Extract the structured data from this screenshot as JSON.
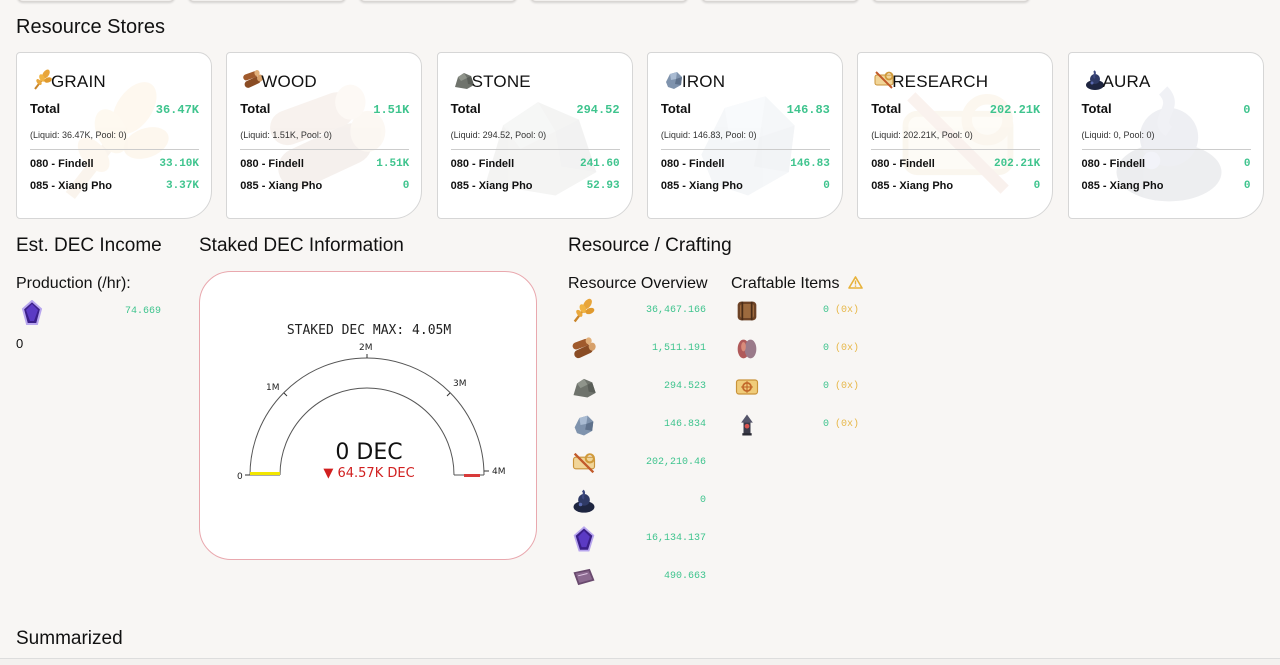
{
  "sections": {
    "resource_stores": "Resource Stores",
    "est_dec_income": "Est. DEC Income",
    "staked_dec_info": "Staked DEC Information",
    "resource_crafting": "Resource / Crafting",
    "summarized": "Summarized"
  },
  "cards": [
    {
      "name": "GRAIN",
      "total_label": "Total",
      "total": "36.47K",
      "sub": "(Liquid: 36.47K, Pool: 0)",
      "rows": [
        {
          "label": "080 - Findell",
          "value": "33.10K"
        },
        {
          "label": "085 - Xiang Pho",
          "value": "3.37K"
        }
      ],
      "color": "#e0a23a"
    },
    {
      "name": "WOOD",
      "total_label": "Total",
      "total": "1.51K",
      "sub": "(Liquid: 1.51K, Pool: 0)",
      "rows": [
        {
          "label": "080 - Findell",
          "value": "1.51K"
        },
        {
          "label": "085 - Xiang Pho",
          "value": "0"
        }
      ],
      "color": "#9a5a2e"
    },
    {
      "name": "STONE",
      "total_label": "Total",
      "total": "294.52",
      "sub": "(Liquid: 294.52, Pool: 0)",
      "rows": [
        {
          "label": "080 - Findell",
          "value": "241.60"
        },
        {
          "label": "085 - Xiang Pho",
          "value": "52.93"
        }
      ],
      "color": "#7c7f78"
    },
    {
      "name": "IRON",
      "total_label": "Total",
      "total": "146.83",
      "sub": "(Liquid: 146.83, Pool: 0)",
      "rows": [
        {
          "label": "080 - Findell",
          "value": "146.83"
        },
        {
          "label": "085 - Xiang Pho",
          "value": "0"
        }
      ],
      "color": "#8fa1b8"
    },
    {
      "name": "RESEARCH",
      "total_label": "Total",
      "total": "202.21K",
      "sub": "(Liquid: 202.21K, Pool: 0)",
      "rows": [
        {
          "label": "080 - Findell",
          "value": "202.21K"
        },
        {
          "label": "085 - Xiang Pho",
          "value": "0"
        }
      ],
      "color": "#e8b64a"
    },
    {
      "name": "AURA",
      "total_label": "Total",
      "total": "0",
      "sub": "(Liquid: 0, Pool: 0)",
      "rows": [
        {
          "label": "080 - Findell",
          "value": "0"
        },
        {
          "label": "085 - Xiang Pho",
          "value": "0"
        }
      ],
      "color": "#2b3550"
    }
  ],
  "income": {
    "production_label": "Production (/hr):",
    "production_value": "74.669",
    "second_value": "0"
  },
  "gauge": {
    "max_label": "STAKED DEC MAX: 4.05M",
    "value_label": "0 DEC",
    "delta_label": "▼ 64.57K DEC",
    "ticks": [
      "0",
      "1M",
      "2M",
      "3M",
      "4M"
    ],
    "value_fraction": 0,
    "colors": {
      "low": "#f2e600",
      "high": "#d83a3a",
      "delta": "#d11f1f"
    }
  },
  "resource_overview": {
    "title": "Resource Overview",
    "rows": [
      {
        "icon": "grain-icon",
        "value": "36,467.166"
      },
      {
        "icon": "wood-icon",
        "value": "1,511.191"
      },
      {
        "icon": "stone-icon",
        "value": "294.523"
      },
      {
        "icon": "iron-icon",
        "value": "146.834"
      },
      {
        "icon": "research-icon",
        "value": "202,210.46"
      },
      {
        "icon": "aura-icon",
        "value": "0"
      },
      {
        "icon": "dec-crystal-icon",
        "value": "16,134.137"
      },
      {
        "icon": "book-icon",
        "value": "490.663"
      }
    ]
  },
  "craftable": {
    "title": "Craftable Items",
    "warn_icon": "warning-icon",
    "rows": [
      {
        "icon": "chest-icon",
        "value": "0",
        "mult": "(0x)"
      },
      {
        "icon": "seeds-icon",
        "value": "0",
        "mult": "(0x)"
      },
      {
        "icon": "scroll-icon",
        "value": "0",
        "mult": "(0x)"
      },
      {
        "icon": "totem-icon",
        "value": "0",
        "mult": "(0x)"
      }
    ]
  }
}
